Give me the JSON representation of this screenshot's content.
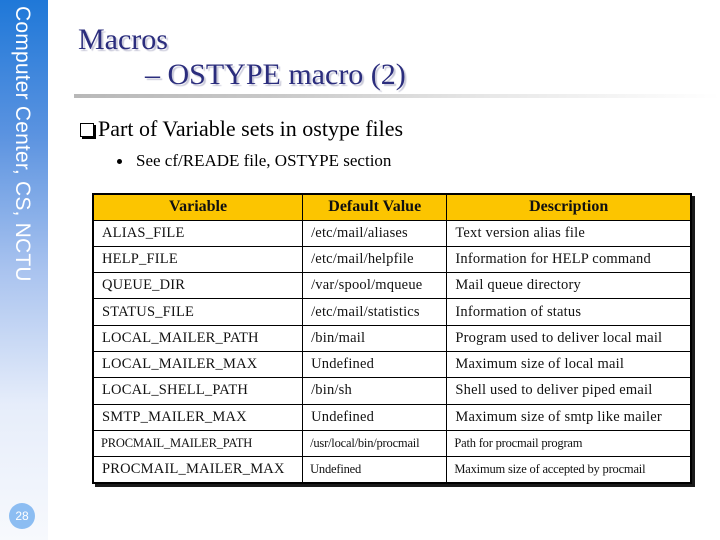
{
  "sidebar": {
    "org_label": "Computer Center, CS, NCTU",
    "page_number": "28"
  },
  "slide": {
    "title_line1": "Macros",
    "title_line2": "– OSTYPE macro (2)",
    "bullet_main": "Part of Variable sets in ostype files",
    "bullet_sub": "See cf/READE file, OSTYPE section"
  },
  "table": {
    "headers": [
      "Variable",
      "Default Value",
      "Description"
    ],
    "rows": [
      [
        "ALIAS_FILE",
        "/etc/mail/aliases",
        "Text version alias file"
      ],
      [
        "HELP_FILE",
        "/etc/mail/helpfile",
        "Information for HELP command"
      ],
      [
        "QUEUE_DIR",
        "/var/spool/mqueue",
        "Mail queue directory"
      ],
      [
        "STATUS_FILE",
        "/etc/mail/statistics",
        "Information of status"
      ],
      [
        "LOCAL_MAILER_PATH",
        "/bin/mail",
        "Program used to deliver local mail"
      ],
      [
        "LOCAL_MAILER_MAX",
        "Undefined",
        "Maximum size of local mail"
      ],
      [
        "LOCAL_SHELL_PATH",
        "/bin/sh",
        "Shell used to deliver piped email"
      ],
      [
        "SMTP_MAILER_MAX",
        "Undefined",
        "Maximum size of smtp like mailer"
      ],
      [
        "PROCMAIL_MAILER_PATH",
        "/usr/local/bin/procmail",
        "Path for procmail program"
      ],
      [
        "PROCMAIL_MAILER_MAX",
        "Undefined",
        "Maximum size of accepted by procmail"
      ]
    ]
  },
  "colors": {
    "title": "#2b2d7d",
    "header_fill": "#fcc500",
    "sidebar_top": "#1f78d8"
  }
}
